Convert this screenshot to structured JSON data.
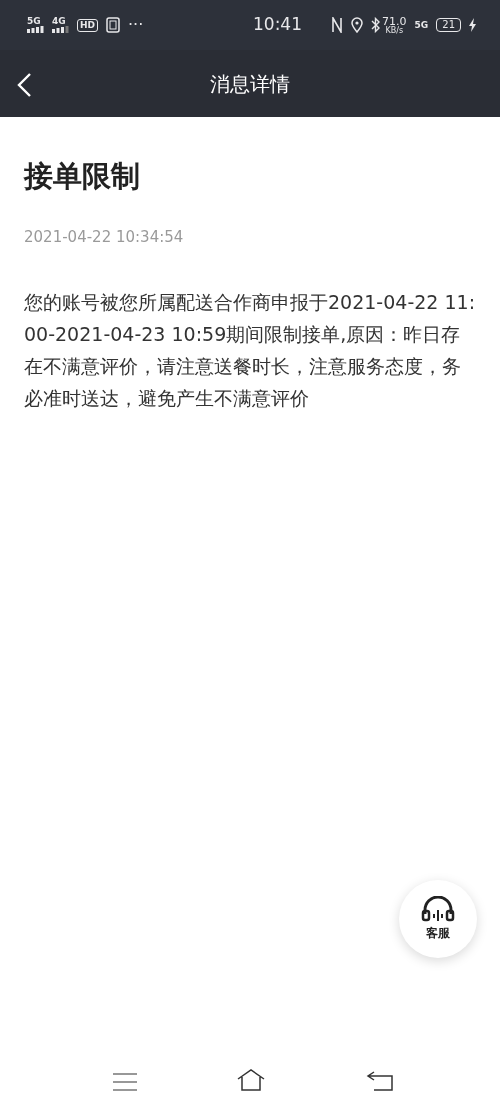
{
  "status_bar": {
    "left_labels": [
      "5G",
      "4G",
      "HD"
    ],
    "more": "···",
    "time": "10:41",
    "speed": "71.0",
    "speed_unit": "KB/s",
    "network": "5G",
    "battery": "21",
    "charging": true
  },
  "header": {
    "title": "消息详情"
  },
  "message": {
    "title": "接单限制",
    "time": "2021-04-22 10:34:54",
    "body": "您的账号被您所属配送合作商申报于2021-04-22 11:00-2021-04-23 10:59期间限制接单,原因：昨日存在不满意评价，请注意送餐时长，注意服务态度，务必准时送达，避免产生不满意评价"
  },
  "support_button": {
    "label": "客服"
  }
}
